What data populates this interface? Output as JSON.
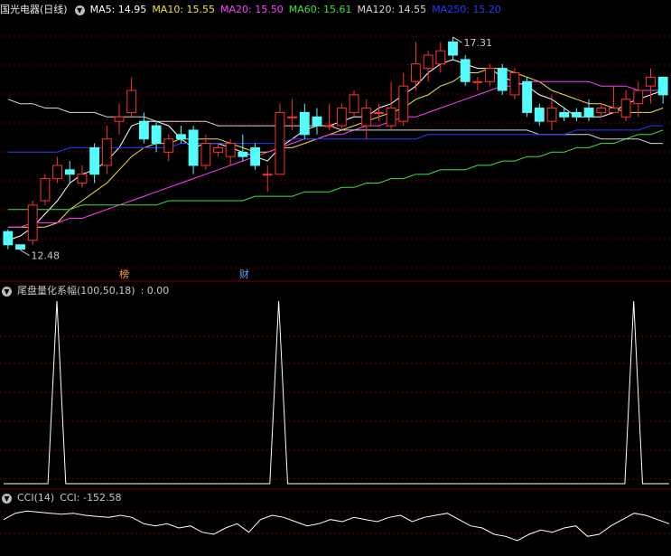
{
  "header": {
    "title": "国光电器(日线)",
    "ma": [
      {
        "label": "MA5: 14.95",
        "color": "#ffffff"
      },
      {
        "label": "MA10: 15.55",
        "color": "#f0e040"
      },
      {
        "label": "MA20: 15.50",
        "color": "#ff40ff"
      },
      {
        "label": "MA60: 15.61",
        "color": "#40e040"
      },
      {
        "label": "MA120: 14.55",
        "color": "#d8d8d8"
      },
      {
        "label": "MA250: 15.20",
        "color": "#2a3aff"
      }
    ]
  },
  "indicator1": {
    "title": "尾盘量化系幅(100,50,18)",
    "value": ": 0.00"
  },
  "indicator2": {
    "title": "CCI(14)",
    "value": "CCI: -152.58"
  },
  "badges": {
    "bang": "榜",
    "cai": "财"
  },
  "colors": {
    "up": "#ff3232",
    "down": "#54fcfc",
    "grid": "#7a0000",
    "bg": "#000000"
  },
  "chart_data": {
    "type": "candlestick",
    "price_ylim": [
      12.0,
      17.7
    ],
    "annotations": {
      "high": "17.31",
      "low": "12.48"
    },
    "candles": [
      [
        12.9,
        12.6,
        12.95,
        12.5
      ],
      [
        12.6,
        12.5,
        12.6,
        12.48
      ],
      [
        12.7,
        13.5,
        13.6,
        12.6
      ],
      [
        13.6,
        14.1,
        14.2,
        13.5
      ],
      [
        14.1,
        14.4,
        14.6,
        14.0
      ],
      [
        14.3,
        14.2,
        14.5,
        14.0
      ],
      [
        14.0,
        14.2,
        14.4,
        13.9
      ],
      [
        14.8,
        14.2,
        14.9,
        14.0
      ],
      [
        14.4,
        15.0,
        15.3,
        14.2
      ],
      [
        15.4,
        15.5,
        15.8,
        15.1
      ],
      [
        15.6,
        16.1,
        16.4,
        15.5
      ],
      [
        15.4,
        15.0,
        15.6,
        14.9
      ],
      [
        15.3,
        14.9,
        15.4,
        14.7
      ],
      [
        14.7,
        15.0,
        15.1,
        14.5
      ],
      [
        15.1,
        15.0,
        15.3,
        14.9
      ],
      [
        15.2,
        14.4,
        15.3,
        14.2
      ],
      [
        14.4,
        14.9,
        15.1,
        14.3
      ],
      [
        14.7,
        14.8,
        14.9,
        14.6
      ],
      [
        14.6,
        14.9,
        15.0,
        14.4
      ],
      [
        14.7,
        14.6,
        15.1,
        14.5
      ],
      [
        14.8,
        14.4,
        14.9,
        14.3
      ],
      [
        14.2,
        14.2,
        14.4,
        13.8
      ],
      [
        14.2,
        15.6,
        15.8,
        14.2
      ],
      [
        15.5,
        15.5,
        15.9,
        15.2
      ],
      [
        15.6,
        15.1,
        15.8,
        15.0
      ],
      [
        15.5,
        15.3,
        15.7,
        15.1
      ],
      [
        15.3,
        15.3,
        15.8,
        15.2
      ],
      [
        15.3,
        15.7,
        15.8,
        15.2
      ],
      [
        15.6,
        16.0,
        16.1,
        15.5
      ],
      [
        15.3,
        15.7,
        15.9,
        15.0
      ],
      [
        15.6,
        15.6,
        15.8,
        15.4
      ],
      [
        15.3,
        15.7,
        16.3,
        15.2
      ],
      [
        15.4,
        16.2,
        16.5,
        15.3
      ],
      [
        16.3,
        16.7,
        17.2,
        16.1
      ],
      [
        16.6,
        16.9,
        17.0,
        16.3
      ],
      [
        16.7,
        17.0,
        17.2,
        16.5
      ],
      [
        17.2,
        16.9,
        17.31,
        16.8
      ],
      [
        16.8,
        16.3,
        16.9,
        16.2
      ],
      [
        16.3,
        16.3,
        16.4,
        16.1
      ],
      [
        16.3,
        16.6,
        16.7,
        16.2
      ],
      [
        16.6,
        16.1,
        16.7,
        16.0
      ],
      [
        16.0,
        16.5,
        16.6,
        15.9
      ],
      [
        16.3,
        15.6,
        16.4,
        15.5
      ],
      [
        15.7,
        15.4,
        15.8,
        15.3
      ],
      [
        15.4,
        15.7,
        16.0,
        15.2
      ],
      [
        15.6,
        15.5,
        15.7,
        15.4
      ],
      [
        15.6,
        15.5,
        15.7,
        15.4
      ],
      [
        15.7,
        15.5,
        15.9,
        15.4
      ],
      [
        15.6,
        15.7,
        15.8,
        15.5
      ],
      [
        15.6,
        15.7,
        16.2,
        15.6
      ],
      [
        15.5,
        15.9,
        16.1,
        15.4
      ],
      [
        15.8,
        16.1,
        16.3,
        15.5
      ],
      [
        16.2,
        16.4,
        16.6,
        15.8
      ],
      [
        16.4,
        16.0,
        16.4,
        15.8
      ]
    ],
    "ma_series": [
      {
        "color": "#ffffff",
        "values": [
          12.7,
          12.8,
          13.0,
          13.3,
          13.6,
          14.0,
          14.2,
          14.3,
          14.5,
          14.8,
          15.3,
          15.4,
          15.4,
          15.3,
          15.0,
          14.8,
          14.9,
          14.9,
          14.8,
          14.7,
          14.6,
          14.5,
          14.8,
          15.0,
          15.2,
          15.3,
          15.3,
          15.4,
          15.5,
          15.5,
          15.7,
          15.8,
          16.0,
          16.2,
          16.5,
          16.7,
          16.8,
          16.7,
          16.6,
          16.6,
          16.4,
          16.3,
          16.2,
          16.0,
          15.9,
          15.7,
          15.5,
          15.5,
          15.5,
          15.6,
          15.8,
          15.9,
          16.0,
          16.1
        ]
      },
      {
        "color": "#f0e040",
        "values": [
          13.0,
          13.0,
          13.0,
          13.0,
          13.1,
          13.4,
          13.6,
          13.8,
          14.0,
          14.3,
          14.6,
          14.8,
          14.9,
          14.9,
          15.0,
          15.0,
          15.0,
          15.0,
          14.9,
          14.8,
          14.7,
          14.7,
          14.8,
          14.8,
          14.9,
          15.0,
          15.1,
          15.2,
          15.3,
          15.4,
          15.5,
          15.6,
          15.7,
          15.9,
          16.0,
          16.2,
          16.3,
          16.5,
          16.5,
          16.6,
          16.6,
          16.5,
          16.4,
          16.3,
          16.1,
          16.0,
          15.9,
          15.8,
          15.8,
          15.7,
          15.6,
          15.6,
          15.6,
          15.7
        ]
      },
      {
        "color": "#ff40ff",
        "values": [
          13.0,
          13.0,
          13.1,
          13.1,
          13.1,
          13.2,
          13.2,
          13.3,
          13.4,
          13.5,
          13.6,
          13.7,
          13.8,
          13.9,
          14.0,
          14.1,
          14.2,
          14.3,
          14.4,
          14.5,
          14.6,
          14.7,
          14.8,
          14.9,
          15.0,
          15.0,
          15.1,
          15.1,
          15.2,
          15.3,
          15.3,
          15.4,
          15.5,
          15.5,
          15.6,
          15.7,
          15.8,
          15.9,
          16.0,
          16.1,
          16.2,
          16.2,
          16.3,
          16.3,
          16.3,
          16.3,
          16.3,
          16.3,
          16.2,
          16.2,
          16.2,
          16.1,
          16.1,
          16.1
        ]
      },
      {
        "color": "#40e040",
        "values": [
          13.4,
          13.4,
          13.4,
          13.4,
          13.4,
          13.4,
          13.5,
          13.5,
          13.5,
          13.5,
          13.5,
          13.5,
          13.5,
          13.6,
          13.6,
          13.6,
          13.6,
          13.6,
          13.6,
          13.6,
          13.7,
          13.7,
          13.7,
          13.7,
          13.8,
          13.8,
          13.8,
          13.9,
          13.9,
          14.0,
          14.0,
          14.1,
          14.1,
          14.2,
          14.2,
          14.3,
          14.3,
          14.3,
          14.4,
          14.4,
          14.5,
          14.5,
          14.6,
          14.6,
          14.7,
          14.7,
          14.8,
          14.8,
          14.9,
          14.9,
          15.0,
          15.1,
          15.1,
          15.2
        ]
      },
      {
        "color": "#d8d8d8",
        "values": [
          15.9,
          15.8,
          15.8,
          15.7,
          15.7,
          15.6,
          15.6,
          15.6,
          15.5,
          15.5,
          15.5,
          15.5,
          15.4,
          15.4,
          15.4,
          15.4,
          15.4,
          15.3,
          15.3,
          15.3,
          15.3,
          15.3,
          15.3,
          15.3,
          15.3,
          15.3,
          15.3,
          15.2,
          15.2,
          15.2,
          15.2,
          15.2,
          15.2,
          15.2,
          15.2,
          15.2,
          15.2,
          15.2,
          15.2,
          15.2,
          15.2,
          15.2,
          15.2,
          15.1,
          15.1,
          15.1,
          15.1,
          15.1,
          15.0,
          15.0,
          15.0,
          15.0,
          14.9,
          14.9
        ]
      },
      {
        "color": "#2a3aff",
        "values": [
          14.7,
          14.7,
          14.7,
          14.7,
          14.7,
          14.8,
          14.8,
          14.8,
          14.8,
          14.8,
          14.8,
          14.8,
          14.8,
          14.8,
          14.9,
          14.9,
          14.9,
          14.9,
          14.9,
          14.9,
          14.9,
          14.9,
          14.9,
          15.0,
          15.0,
          15.0,
          15.0,
          15.0,
          15.0,
          15.0,
          15.0,
          15.0,
          15.0,
          15.0,
          15.1,
          15.1,
          15.1,
          15.1,
          15.1,
          15.1,
          15.1,
          15.1,
          15.1,
          15.1,
          15.1,
          15.1,
          15.2,
          15.2,
          15.2,
          15.2,
          15.2,
          15.2,
          15.3,
          15.3
        ]
      }
    ],
    "indicator1_values": [
      0,
      0,
      0,
      0,
      0,
      0,
      1,
      0,
      0,
      0,
      0,
      0,
      0,
      0,
      0,
      0,
      0,
      0,
      0,
      0,
      0,
      0,
      0,
      0,
      0,
      0,
      0,
      0,
      0,
      0,
      0,
      1,
      0,
      0,
      0,
      0,
      0,
      0,
      0,
      0,
      0,
      0,
      0,
      0,
      0,
      0,
      0,
      0,
      0,
      0,
      0,
      0,
      0,
      0,
      0,
      0,
      0,
      0,
      0,
      0,
      0,
      0,
      0,
      0,
      0,
      0,
      0,
      0,
      0,
      0,
      0,
      1,
      0,
      0,
      0,
      0
    ],
    "cci_values": [
      -40,
      -10,
      0,
      -5,
      -10,
      -15,
      -10,
      -20,
      -25,
      -30,
      -20,
      -30,
      -60,
      -70,
      -60,
      -80,
      -70,
      -100,
      -110,
      -80,
      -60,
      -100,
      -40,
      -20,
      -30,
      -50,
      -70,
      -60,
      -40,
      -50,
      -30,
      -40,
      -50,
      -30,
      -20,
      -50,
      -30,
      -20,
      -10,
      -40,
      -70,
      -80,
      -110,
      -120,
      -140,
      -110,
      -90,
      -100,
      -80,
      -70,
      -120,
      -110,
      -70,
      -40,
      -10,
      -20,
      -40,
      -60
    ]
  }
}
